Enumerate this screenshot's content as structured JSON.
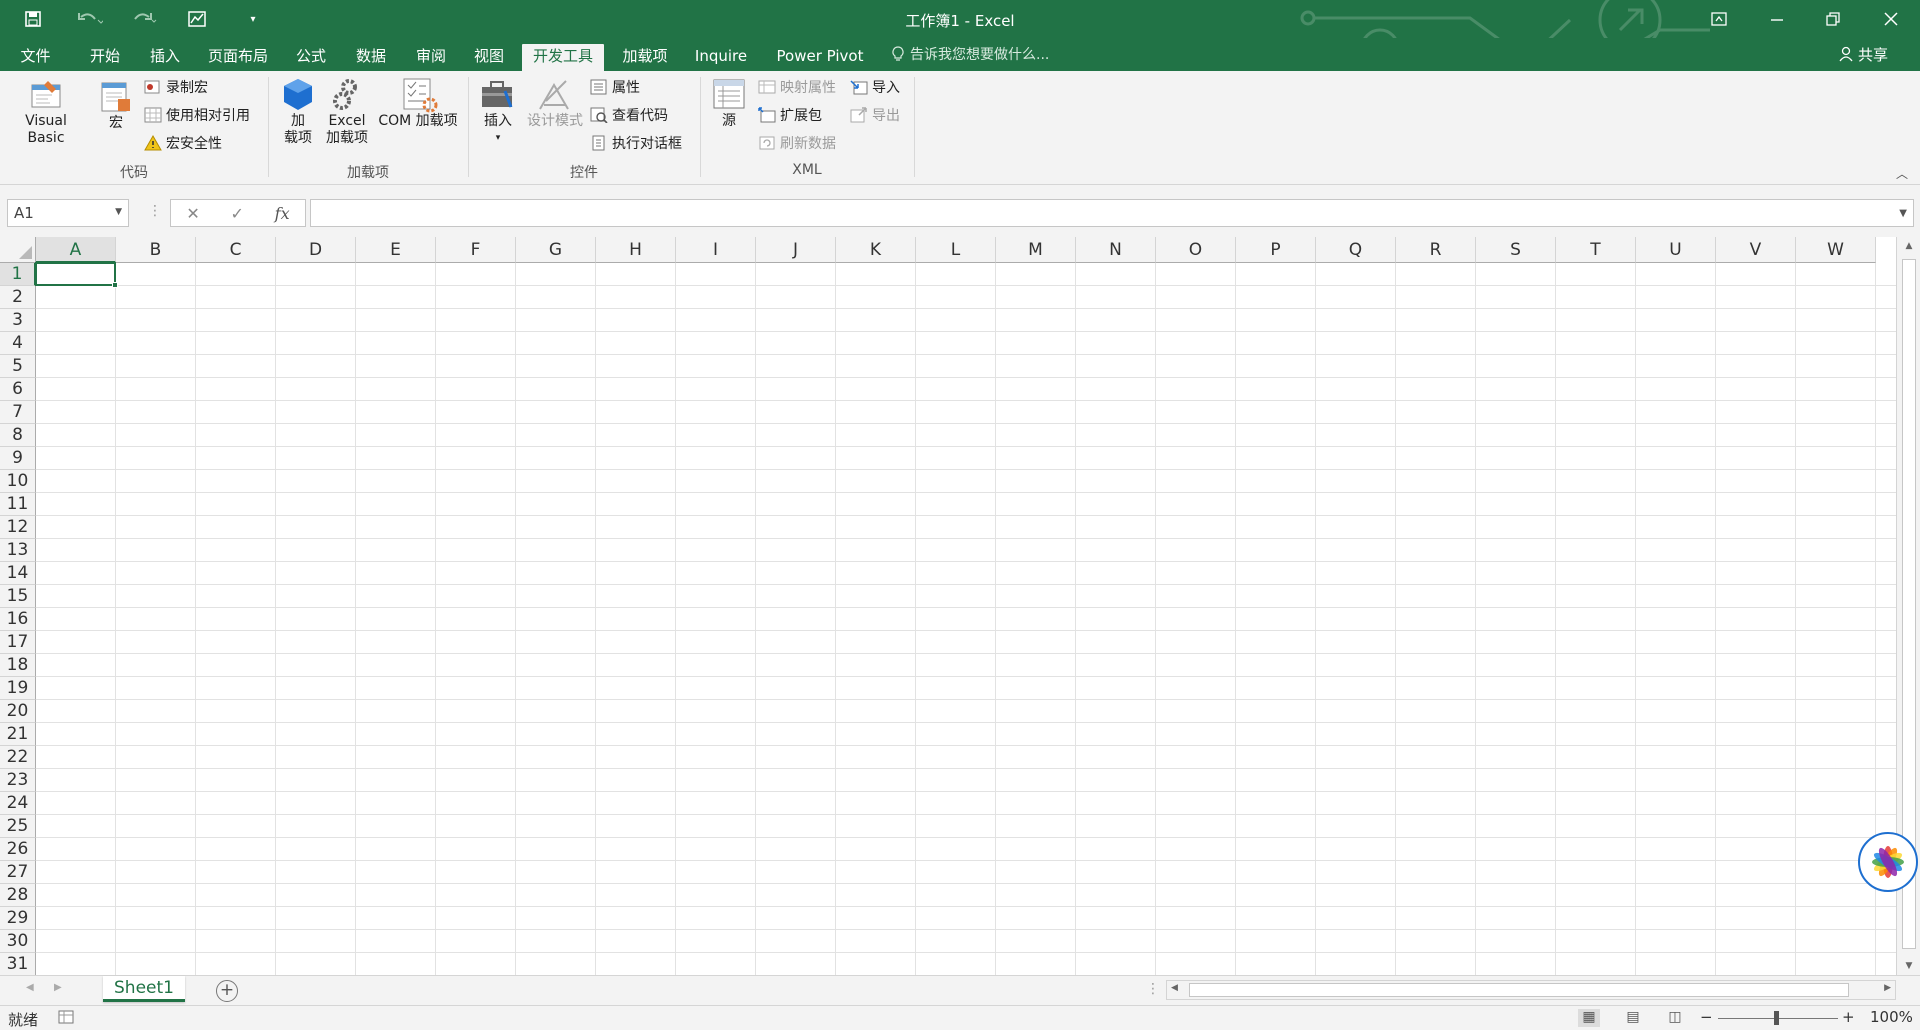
{
  "window": {
    "title": "工作簿1 - Excel"
  },
  "tabs": [
    {
      "label": "文件",
      "active": false
    },
    {
      "label": "开始",
      "active": false
    },
    {
      "label": "插入",
      "active": false
    },
    {
      "label": "页面布局",
      "active": false
    },
    {
      "label": "公式",
      "active": false
    },
    {
      "label": "数据",
      "active": false
    },
    {
      "label": "审阅",
      "active": false
    },
    {
      "label": "视图",
      "active": false
    },
    {
      "label": "开发工具",
      "active": true
    },
    {
      "label": "加载项",
      "active": false
    },
    {
      "label": "Inquire",
      "active": false
    },
    {
      "label": "Power Pivot",
      "active": false
    }
  ],
  "tellme": "告诉我您想要做什么...",
  "share": "共享",
  "ribbon": {
    "code": {
      "group_label": "代码",
      "visual_basic": "Visual Basic",
      "macros": "宏",
      "record_macro": "录制宏",
      "relative_refs": "使用相对引用",
      "macro_security": "宏安全性"
    },
    "addins": {
      "group_label": "加载项",
      "addins_1": "加",
      "addins_2": "载项",
      "excel_addins_1": "Excel",
      "excel_addins_2": "加载项",
      "com_addins": "COM 加载项"
    },
    "controls": {
      "group_label": "控件",
      "insert": "插入",
      "design_mode": "设计模式",
      "properties": "属性",
      "view_code": "查看代码",
      "run_dialog": "执行对话框"
    },
    "xml": {
      "group_label": "XML",
      "source": "源",
      "map_properties": "映射属性",
      "expansion_packs": "扩展包",
      "refresh_data": "刷新数据",
      "import": "导入",
      "export": "导出"
    }
  },
  "formula_bar": {
    "name_box": "A1",
    "fx": "fx",
    "value": ""
  },
  "grid": {
    "columns": [
      "A",
      "B",
      "C",
      "D",
      "E",
      "F",
      "G",
      "H",
      "I",
      "J",
      "K",
      "L",
      "M",
      "N",
      "O",
      "P",
      "Q",
      "R",
      "S",
      "T",
      "U",
      "V",
      "W"
    ],
    "rows": [
      "1",
      "2",
      "3",
      "4",
      "5",
      "6",
      "7",
      "8",
      "9",
      "10",
      "11",
      "12",
      "13",
      "14",
      "15",
      "16",
      "17",
      "18",
      "19",
      "20",
      "21",
      "22",
      "23",
      "24",
      "25",
      "26",
      "27",
      "28",
      "29",
      "30",
      "31"
    ],
    "active_cell": "A1"
  },
  "sheets": [
    {
      "name": "Sheet1",
      "active": true
    }
  ],
  "status": {
    "ready": "就绪",
    "zoom": "100%"
  },
  "colors": {
    "accent": "#217346",
    "ribbon_bg": "#f3f3f3"
  }
}
